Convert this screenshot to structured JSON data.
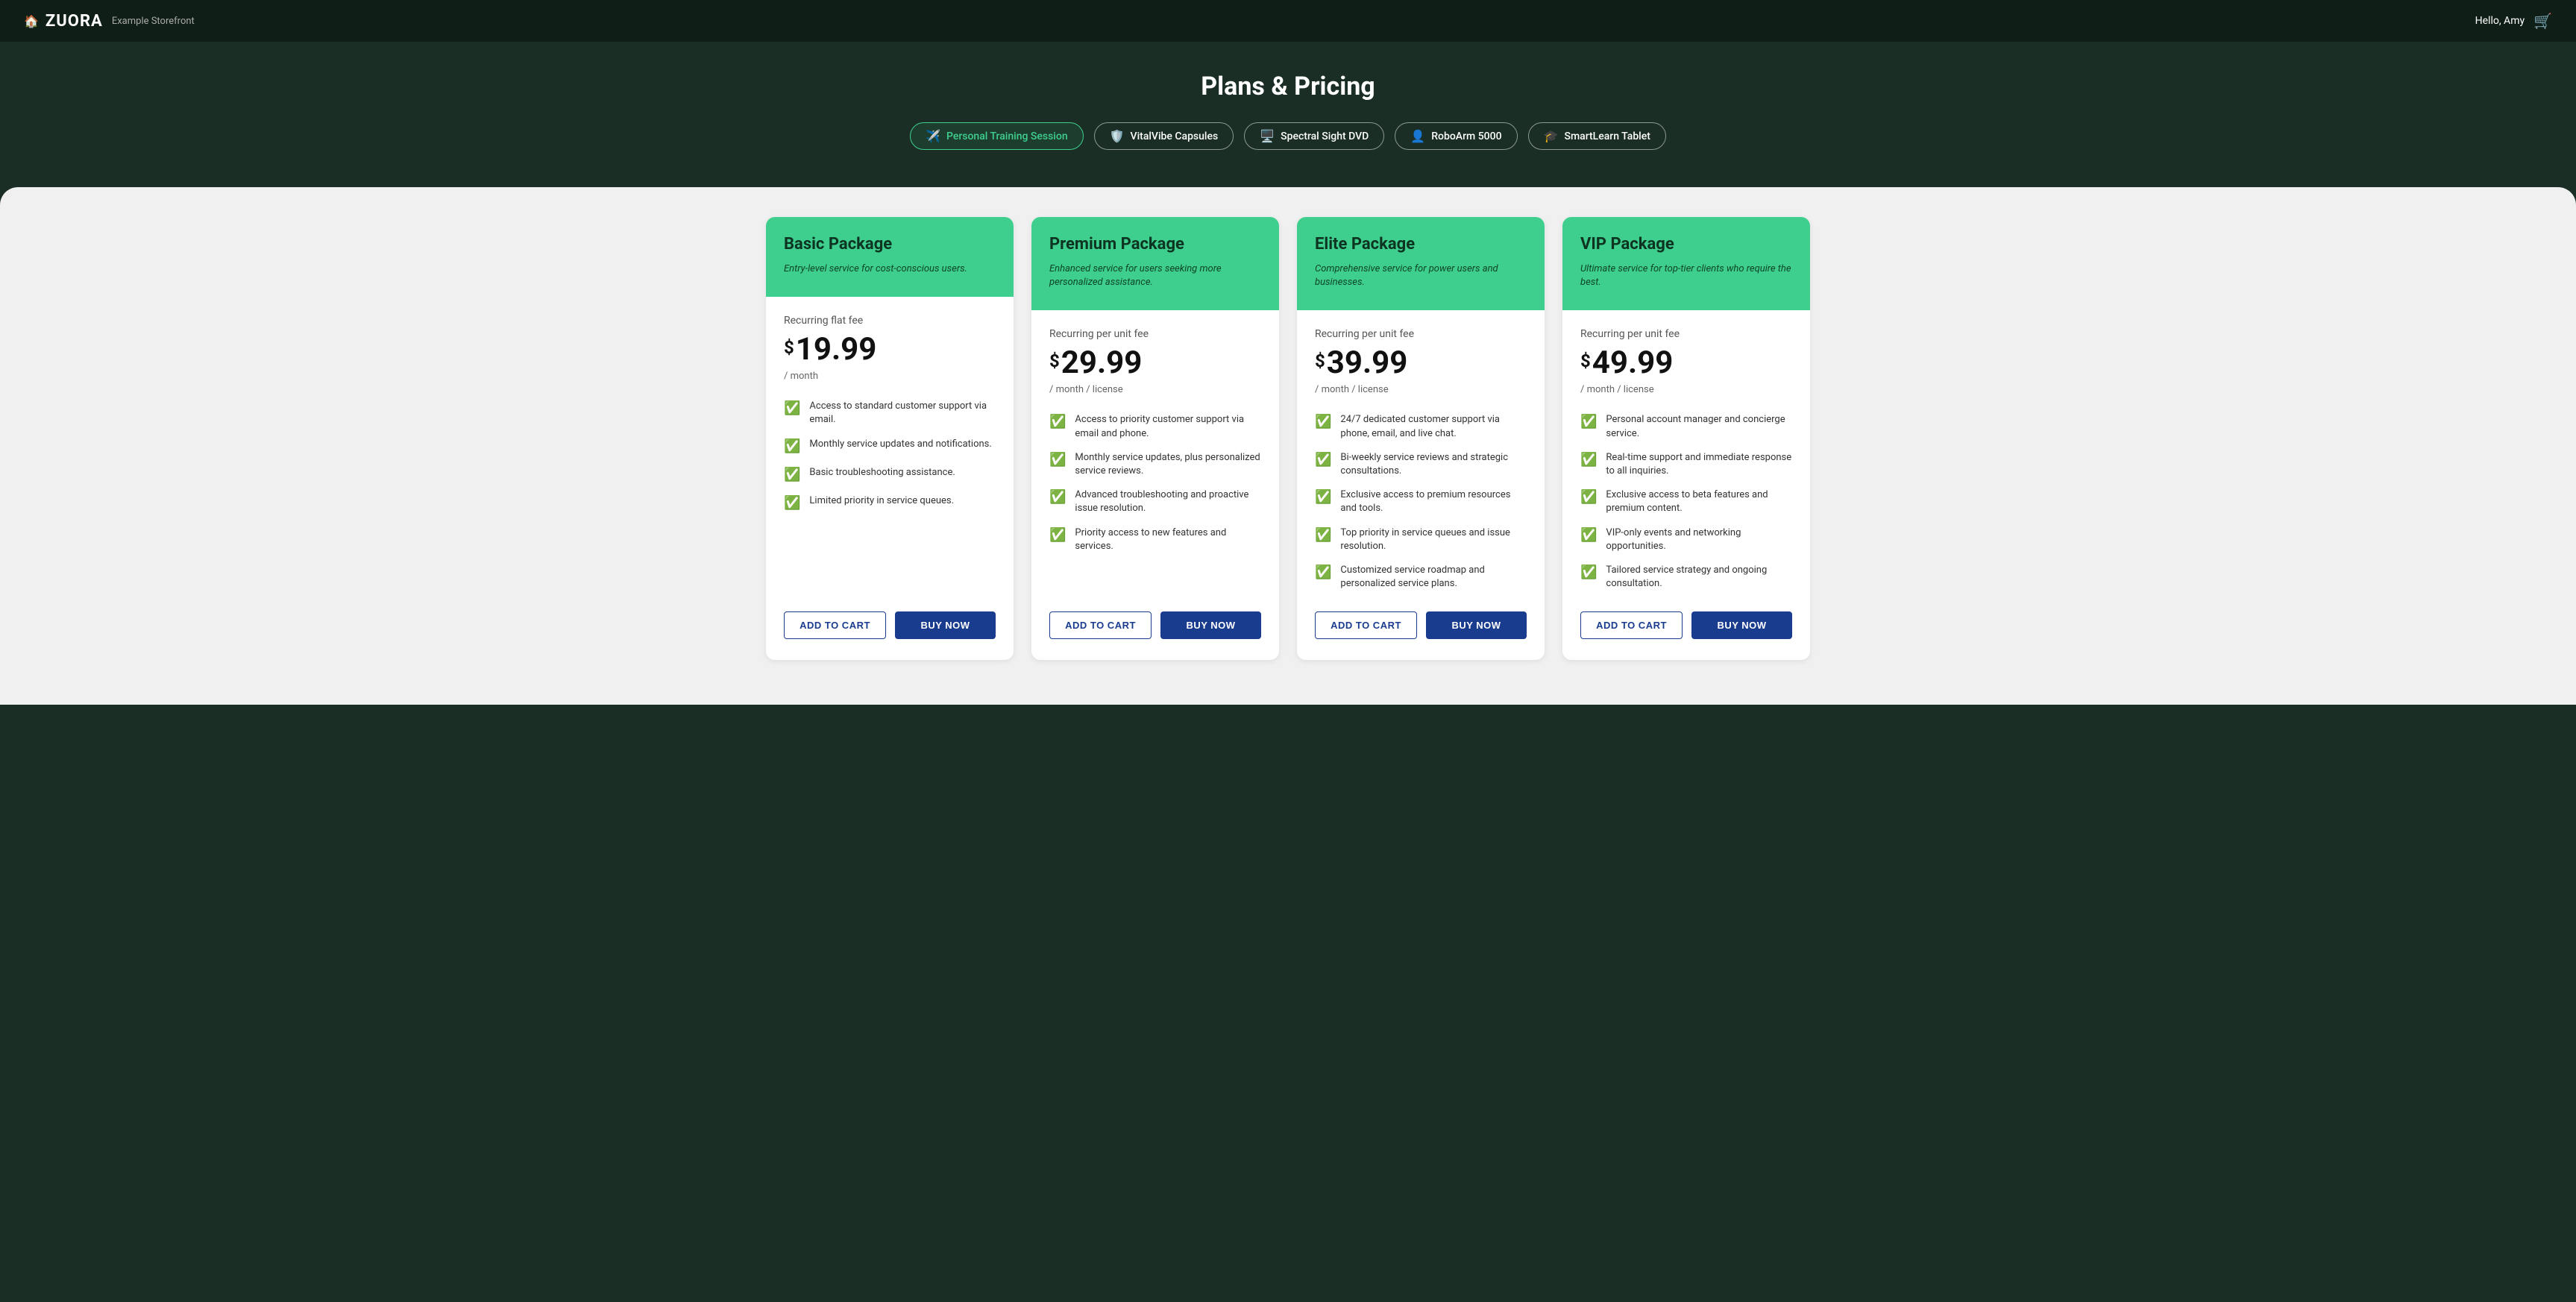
{
  "navbar": {
    "logo": "ZUORA",
    "home_icon": "🏠",
    "subtitle": "Example Storefront",
    "greeting": "Hello, Amy",
    "cart_icon": "🛒"
  },
  "hero": {
    "title": "Plans & Pricing"
  },
  "tabs": [
    {
      "id": "personal-training",
      "label": "Personal Training Session",
      "icon": "✈",
      "active": true
    },
    {
      "id": "vitalvibe",
      "label": "VitalVibe Capsules",
      "icon": "🛡",
      "active": false
    },
    {
      "id": "spectral-sight",
      "label": "Spectral Sight DVD",
      "icon": "🖥",
      "active": false
    },
    {
      "id": "roboarm",
      "label": "RoboArm 5000",
      "icon": "👤",
      "active": false
    },
    {
      "id": "smartlearn",
      "label": "SmartLearn Tablet",
      "icon": "🎓",
      "active": false
    }
  ],
  "pricing_cards": [
    {
      "id": "basic",
      "title": "Basic Package",
      "description": "Entry-level service for cost-conscious users.",
      "pricing_label": "Recurring flat fee",
      "price_dollar": "$",
      "price_amount": "19.99",
      "price_period": "/ month",
      "features": [
        "Access to standard customer support via email.",
        "Monthly service updates and notifications.",
        "Basic troubleshooting assistance.",
        "Limited priority in service queues."
      ],
      "btn_add_cart": "ADD TO CART",
      "btn_buy_now": "BUY NOW"
    },
    {
      "id": "premium",
      "title": "Premium Package",
      "description": "Enhanced service for users seeking more personalized assistance.",
      "pricing_label": "Recurring per unit fee",
      "price_dollar": "$",
      "price_amount": "29.99",
      "price_period": "/ month / license",
      "features": [
        "Access to priority customer support via email and phone.",
        "Monthly service updates, plus personalized service reviews.",
        "Advanced troubleshooting and proactive issue resolution.",
        "Priority access to new features and services."
      ],
      "btn_add_cart": "ADD TO CART",
      "btn_buy_now": "BUY NOW"
    },
    {
      "id": "elite",
      "title": "Elite Package",
      "description": "Comprehensive service for power users and businesses.",
      "pricing_label": "Recurring per unit fee",
      "price_dollar": "$",
      "price_amount": "39.99",
      "price_period": "/ month / license",
      "features": [
        "24/7 dedicated customer support via phone, email, and live chat.",
        "Bi-weekly service reviews and strategic consultations.",
        "Exclusive access to premium resources and tools.",
        "Top priority in service queues and issue resolution.",
        "Customized service roadmap and personalized service plans."
      ],
      "btn_add_cart": "ADD TO CART",
      "btn_buy_now": "BUY NOW"
    },
    {
      "id": "vip",
      "title": "VIP Package",
      "description": "Ultimate service for top-tier clients who require the best.",
      "pricing_label": "Recurring per unit fee",
      "price_dollar": "$",
      "price_amount": "49.99",
      "price_period": "/ month / license",
      "features": [
        "Personal account manager and concierge service.",
        "Real-time support and immediate response to all inquiries.",
        "Exclusive access to beta features and premium content.",
        "VIP-only events and networking opportunities.",
        "Tailored service strategy and ongoing consultation."
      ],
      "btn_add_cart": "ADD TO CART",
      "btn_buy_now": "BUY NOW"
    }
  ]
}
